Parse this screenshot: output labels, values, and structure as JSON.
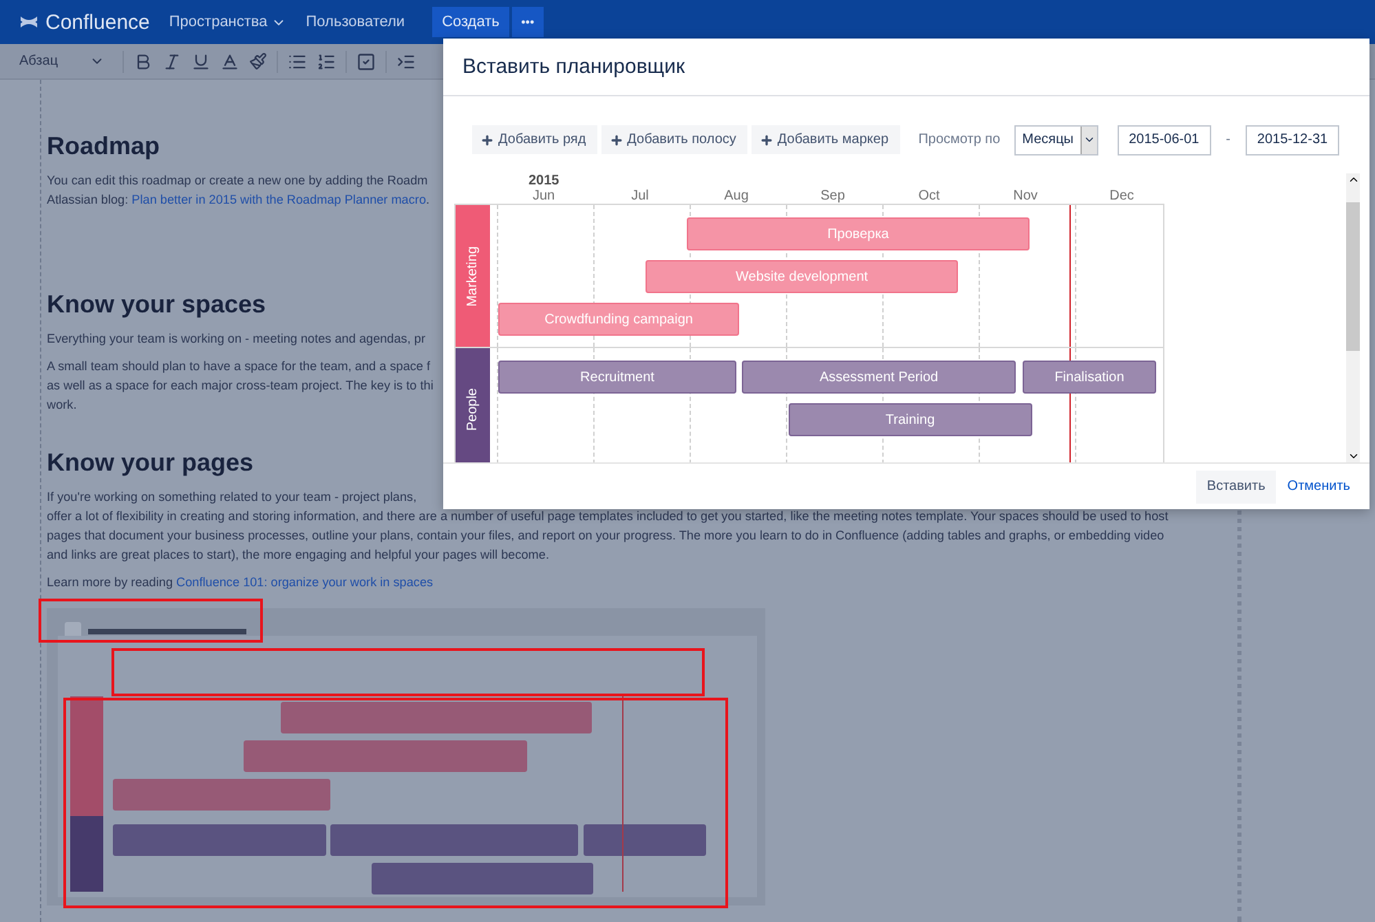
{
  "top_bar": {
    "logo": "Confluence",
    "nav": [
      {
        "label": "Пространства",
        "has_menu": true
      },
      {
        "label": "Пользователи",
        "has_menu": false
      }
    ],
    "create_button": "Создать",
    "more_button": "•••"
  },
  "toolbar": {
    "paragraph_style": "Абзац"
  },
  "page": {
    "sections": [
      {
        "heading": "Roadmap",
        "paragraphs": [
          [
            [
              {
                "text": "You can edit this roadmap or create a new one by adding the Roadm",
                "link": false
              }
            ],
            [
              {
                "text": "Atlassian blog: ",
                "link": false
              },
              {
                "text": "Plan better in 2015 with the Roadmap Planner macro",
                "link": true
              },
              {
                "text": ".",
                "link": false
              }
            ]
          ]
        ]
      },
      {
        "heading": "Know your spaces",
        "paragraphs": [
          [
            [
              {
                "text": "Everything your team is working on - meeting notes and agendas, pr",
                "link": false
              }
            ]
          ],
          [
            [
              {
                "text": "A small team should plan to have a space for the team, and a space f",
                "link": false
              }
            ],
            [
              {
                "text": "as well as a space for each major cross-team project. The key is to thi",
                "link": false
              }
            ],
            [
              {
                "text": "work.",
                "link": false
              }
            ]
          ]
        ]
      },
      {
        "heading": "Know your pages",
        "paragraphs": [
          [
            [
              {
                "text": "If you're working on something related to your team - project plans,",
                "link": false
              }
            ],
            [
              {
                "text": "offer a lot of flexibility in creating and storing information, and there are a number of useful page templates included to get you started, like the meeting notes template. Your spaces should be used to host",
                "link": false
              }
            ],
            [
              {
                "text": "pages that document your business processes, outline your plans, contain your files, and report on your progress. The more you learn to do in Confluence (adding tables and graphs, or embedding video",
                "link": false
              }
            ],
            [
              {
                "text": "and links are great places to start), the more engaging and helpful your pages will become.",
                "link": false
              }
            ]
          ],
          [
            [
              {
                "text": "Learn more by reading ",
                "link": false
              },
              {
                "text": "Confluence 101: organize your work in spaces",
                "link": true
              }
            ]
          ]
        ]
      }
    ]
  },
  "dialog": {
    "title": "Вставить планировщик",
    "actions": [
      "Добавить ряд",
      "Добавить полосу",
      "Добавить маркер"
    ],
    "view_label": "Просмотр по",
    "view_select": "Месяцы",
    "start_date": "2015-06-01",
    "date_separator": "-",
    "end_date": "2015-12-31",
    "year": "2015",
    "months": [
      "Jun",
      "Jul",
      "Aug",
      "Sep",
      "Oct",
      "Nov",
      "Dec"
    ],
    "lanes": [
      {
        "title": "Marketing",
        "color": "#ef5b76",
        "bars": [
          "Проверка",
          "Website development",
          "Crowdfunding campaign"
        ]
      },
      {
        "title": "People",
        "color": "#654982",
        "bars": [
          "Recruitment",
          "Assessment Period",
          "Finalisation",
          "Training"
        ]
      }
    ],
    "insert_button": "Вставить",
    "cancel_button": "Отменить"
  }
}
